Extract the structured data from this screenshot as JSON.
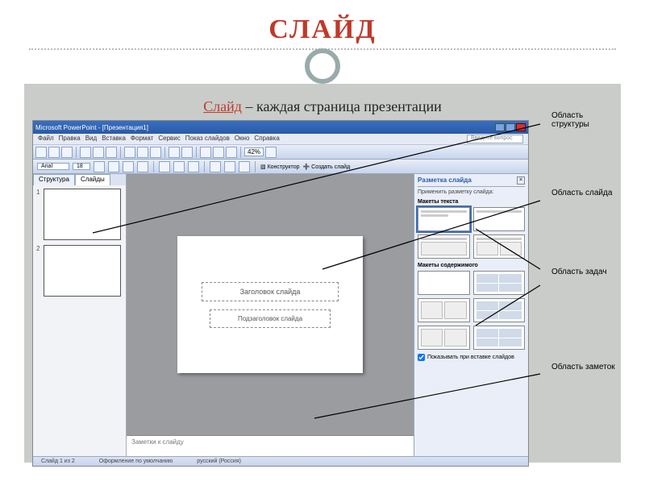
{
  "page": {
    "title": "СЛАЙД",
    "subtitle_highlight": "Слайд",
    "subtitle_rest": " – каждая страница презентации"
  },
  "callouts": {
    "structure": "Область структуры",
    "slide": "Область слайда",
    "task": "Область задач",
    "notes": "Область заметок"
  },
  "pp": {
    "titlebar": "Microsoft PowerPoint - [Презентация1]",
    "ask_placeholder": "Введите вопрос",
    "menus": [
      "Файл",
      "Правка",
      "Вид",
      "Вставка",
      "Формат",
      "Сервис",
      "Показ слайдов",
      "Окно",
      "Справка"
    ],
    "zoom": "42%",
    "tb2": {
      "font": "Arial",
      "size": "18",
      "konstruktor": "Конструктор",
      "new_slide": "Создать слайд"
    },
    "tabs": {
      "outline": "Структура",
      "slides": "Слайды"
    },
    "thumbs": [
      "1",
      "2"
    ],
    "placeholders": {
      "title": "Заголовок слайда",
      "subtitle": "Подзаголовок слайда"
    },
    "notes": "Заметки к слайду",
    "taskpane": {
      "header": "Разметка слайда",
      "apply": "Применить разметку слайда:",
      "sec_text": "Макеты текста",
      "sec_content": "Макеты содержимого",
      "check": "Показывать при вставке слайдов"
    },
    "status": {
      "slide_count": "Слайд 1 из 2",
      "design": "Оформление по умолчанию",
      "lang": "русский (Россия)"
    }
  }
}
